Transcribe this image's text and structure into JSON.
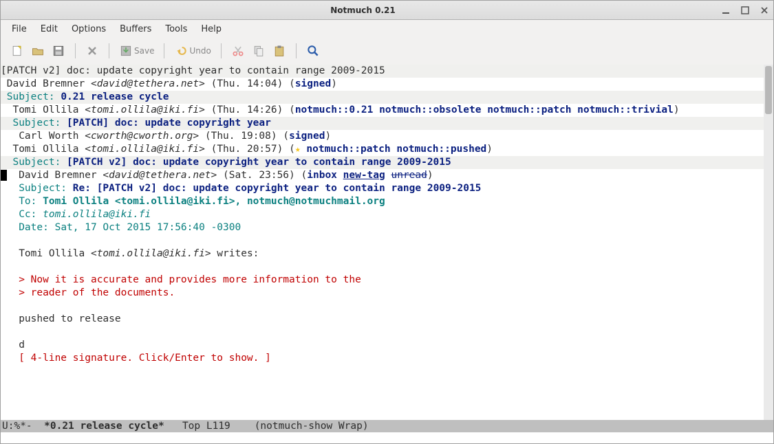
{
  "titlebar": {
    "title": "Notmuch 0.21"
  },
  "menubar": [
    "File",
    "Edit",
    "Options",
    "Buffers",
    "Tools",
    "Help"
  ],
  "toolbar": {
    "save_label": "Save",
    "undo_label": "Undo"
  },
  "thread": {
    "title_line": "[PATCH v2] doc: update copyright year to contain range 2009-2015",
    "msg1": {
      "from_name": "David Bremner",
      "from_email": "david@tethera.net",
      "date": "Thu. 14:04",
      "tags": [
        "signed"
      ]
    },
    "sub1": "0.21 release cycle",
    "msg2": {
      "from_name": "Tomi Ollila",
      "from_email": "tomi.ollila@iki.fi",
      "date": "Thu. 14:26",
      "tags": [
        "notmuch::0.21",
        "notmuch::obsolete",
        "notmuch::patch",
        "notmuch::trivial"
      ]
    },
    "sub2": "[PATCH] doc: update copyright year",
    "msg3": {
      "from_name": "Carl Worth",
      "from_email": "cworth@cworth.org",
      "date": "Thu. 19:08",
      "tags": [
        "signed"
      ]
    },
    "msg4": {
      "from_name": "Tomi Ollila",
      "from_email": "tomi.ollila@iki.fi",
      "date": "Thu. 20:57",
      "tags": [
        "notmuch::patch",
        "notmuch::pushed"
      ]
    },
    "sub3": "[PATCH v2] doc: update copyright year to contain range 2009-2015",
    "msg5": {
      "from_name": "David Bremner",
      "from_email": "david@tethera.net",
      "date": "Sat. 23:56",
      "tag_inbox": "inbox",
      "tag_new": "new-tag",
      "tag_unread": "unread"
    },
    "sub4": "Re: [PATCH v2] doc: update copyright year to contain range 2009-2015",
    "to_line": "Tomi Ollila <tomi.ollila@iki.fi>, notmuch@notmuchmail.org",
    "cc_line": "tomi.ollila@iki.fi",
    "date_line": "Sat, 17 Oct 2015 17:56:40 -0300",
    "body_intro": "Tomi Ollila <",
    "body_intro_email": "tomi.ollila@iki.fi",
    "body_intro_suffix": "> writes:",
    "quote1": "> Now it is accurate and provides more information to the",
    "quote2": "> reader of the documents.",
    "body1": "pushed to release",
    "body2": "d",
    "sig_placeholder": "[ 4-line signature. Click/Enter to show. ]"
  },
  "statusbar": {
    "left": "U:%*-",
    "buffer": "*0.21 release cycle*",
    "pos": "Top L119",
    "mode": "(notmuch-show Wrap)"
  }
}
